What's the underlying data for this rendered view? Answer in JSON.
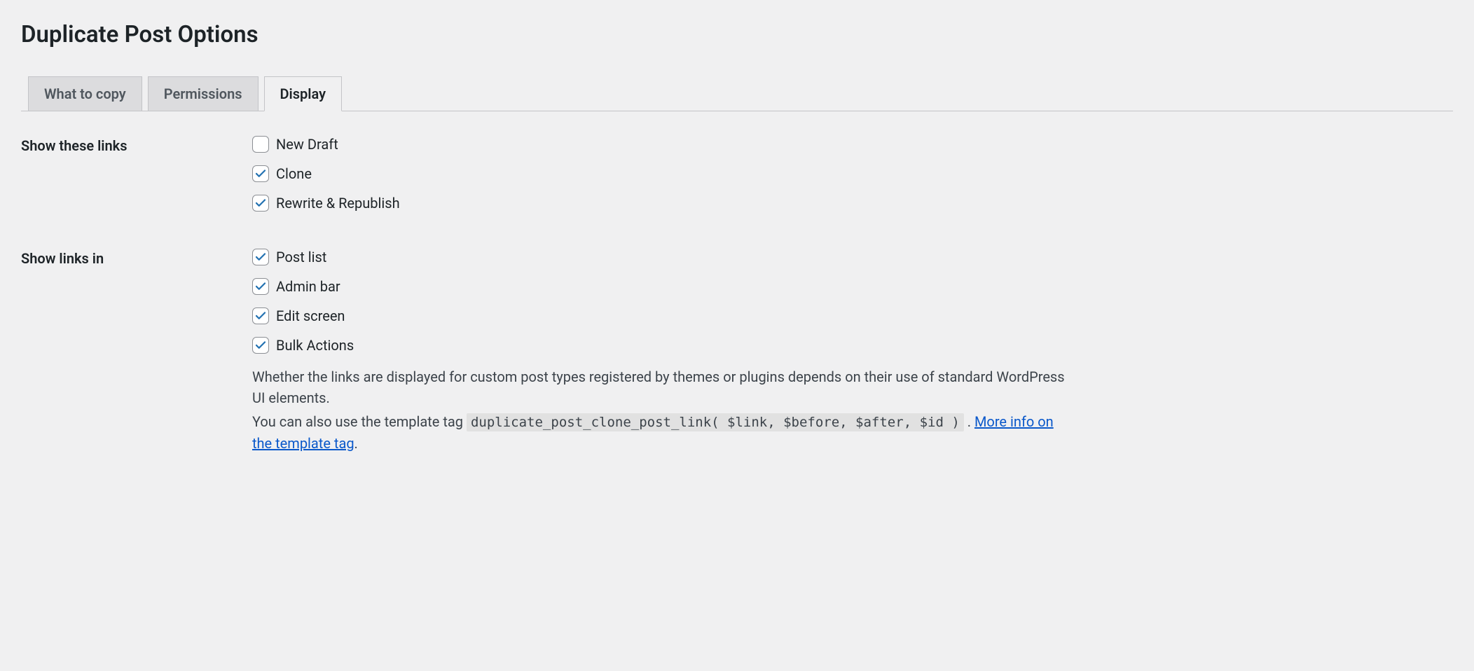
{
  "page": {
    "title": "Duplicate Post Options"
  },
  "tabs": [
    {
      "label": "What to copy",
      "active": false
    },
    {
      "label": "Permissions",
      "active": false
    },
    {
      "label": "Display",
      "active": true
    }
  ],
  "sections": {
    "show_these_links": {
      "label": "Show these links",
      "options": [
        {
          "label": "New Draft",
          "checked": false
        },
        {
          "label": "Clone",
          "checked": true
        },
        {
          "label": "Rewrite & Republish",
          "checked": true
        }
      ]
    },
    "show_links_in": {
      "label": "Show links in",
      "options": [
        {
          "label": "Post list",
          "checked": true
        },
        {
          "label": "Admin bar",
          "checked": true
        },
        {
          "label": "Edit screen",
          "checked": true
        },
        {
          "label": "Bulk Actions",
          "checked": true
        }
      ],
      "description": {
        "line1": "Whether the links are displayed for custom post types registered by themes or plugins depends on their use of standard WordPress UI elements.",
        "line2_prefix": "You can also use the template tag ",
        "code": "duplicate_post_clone_post_link( $link, $before, $after, $id )",
        "line2_suffix": " . ",
        "link_text": "More info on the template tag",
        "period": "."
      }
    }
  }
}
